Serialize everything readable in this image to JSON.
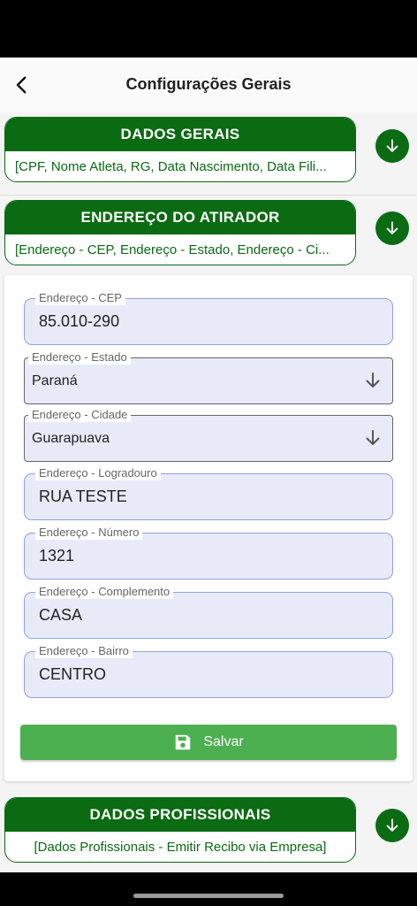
{
  "header": {
    "title": "Configurações Gerais"
  },
  "sections": [
    {
      "title": "DADOS GERAIS",
      "summary": "[CPF, Nome Atleta, RG, Data Nascimento, Data Fili..."
    },
    {
      "title": "ENDEREÇO DO ATIRADOR",
      "summary": "[Endereço - CEP, Endereço - Estado, Endereço - Ci..."
    },
    {
      "title": "DADOS PROFISSIONAIS",
      "summary": "[Dados Profissionais - Emitir Recibo via Empresa]"
    }
  ],
  "form": {
    "cep": {
      "label": "Endereço - CEP",
      "value": "85.010-290"
    },
    "estado": {
      "label": "Endereço - Estado",
      "value": "Paraná"
    },
    "cidade": {
      "label": "Endereço - Cidade",
      "value": "Guarapuava"
    },
    "logradouro": {
      "label": "Endereço - Logradouro",
      "value": "RUA TESTE"
    },
    "numero": {
      "label": "Endereço - Número",
      "value": "1321"
    },
    "complemento": {
      "label": "Endereço - Complemento",
      "value": "CASA"
    },
    "bairro": {
      "label": "Endereço - Bairro",
      "value": "CENTRO"
    },
    "save_label": "Salvar"
  },
  "icons": {
    "back": "chevron-left-icon",
    "expand": "arrow-down-icon",
    "dropdown": "arrow-down-icon",
    "save": "floppy-disk-icon"
  },
  "colors": {
    "primary_green": "#0a6b12",
    "save_green": "#4caf50",
    "field_fill": "#e8ebf7",
    "field_border": "#8da2e8"
  }
}
